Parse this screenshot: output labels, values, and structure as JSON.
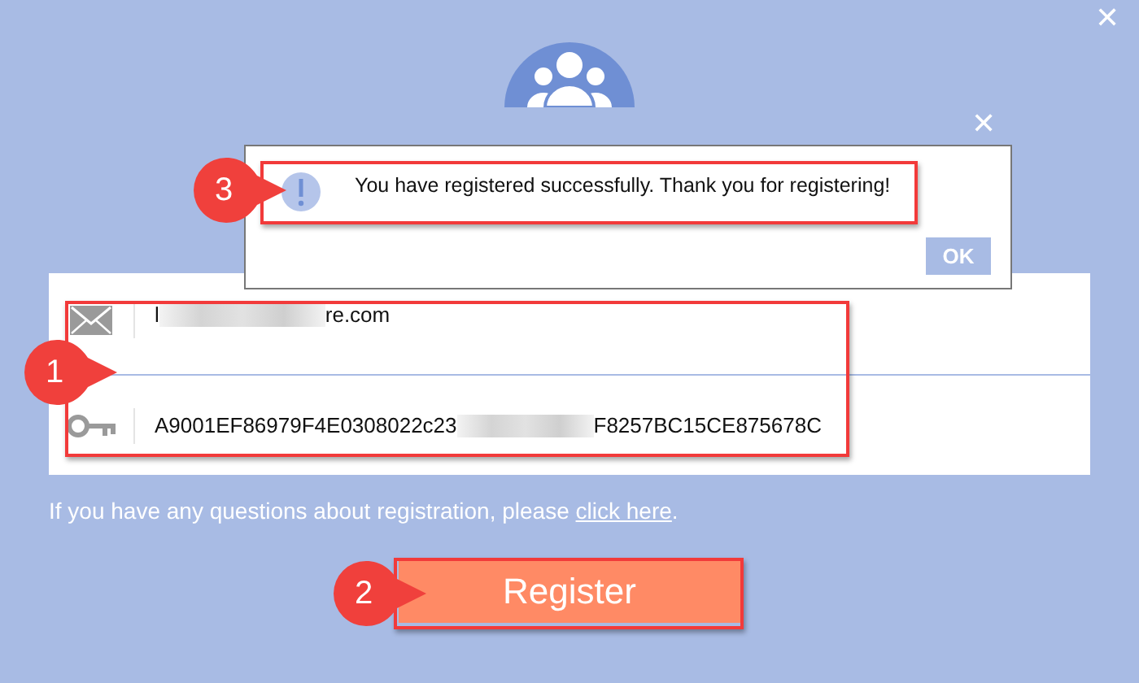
{
  "dialog": {
    "close_label": "✕"
  },
  "message_box": {
    "close_label": "✕",
    "text": "You have registered successfully. Thank you for registering!",
    "button": "OK"
  },
  "fields": [
    {
      "kind": "email",
      "value_start": "l",
      "value_end": "re.com"
    },
    {
      "kind": "key",
      "value_start": "A9001EF86979F4E0308022c23",
      "value_end": "F8257BC15CE875678C"
    }
  ],
  "help": {
    "text": "If you have any questions about registration, please ",
    "link": "click here",
    "end": "."
  },
  "register_button": "Register",
  "annotations": [
    {
      "number": "1",
      "kind": "fields"
    },
    {
      "number": "2",
      "kind": "register"
    },
    {
      "number": "3",
      "kind": "message"
    }
  ]
}
